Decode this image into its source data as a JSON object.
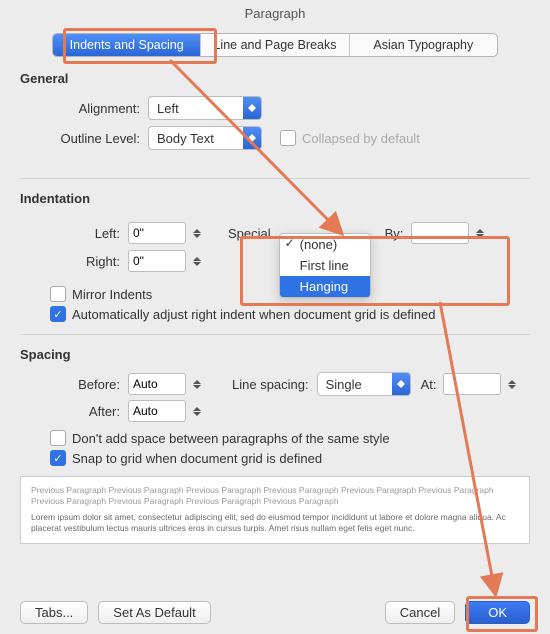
{
  "title": "Paragraph",
  "tabs": [
    "Indents and Spacing",
    "Line and Page Breaks",
    "Asian Typography"
  ],
  "active_tab": 0,
  "general": {
    "title": "General",
    "alignment_label": "Alignment:",
    "alignment_value": "Left",
    "outline_label": "Outline Level:",
    "outline_value": "Body Text",
    "collapsed_label": "Collapsed by default"
  },
  "indentation": {
    "title": "Indentation",
    "left_label": "Left:",
    "left_value": "0\"",
    "right_label": "Right:",
    "right_value": "0\"",
    "special_label": "Special",
    "special_options": [
      "(none)",
      "First line",
      "Hanging"
    ],
    "special_checked": "(none)",
    "special_selected": "Hanging",
    "by_label": "By:",
    "by_value": "",
    "mirror_label": "Mirror Indents",
    "mirror_checked": false,
    "auto_adjust_label": "Automatically adjust right indent when document grid is defined",
    "auto_adjust_checked": true
  },
  "spacing": {
    "title": "Spacing",
    "before_label": "Before:",
    "before_value": "Auto",
    "after_label": "After:",
    "after_value": "Auto",
    "line_spacing_label": "Line spacing:",
    "line_spacing_value": "Single",
    "at_label": "At:",
    "at_value": "",
    "no_space_label": "Don't add space between paragraphs of the same style",
    "no_space_checked": false,
    "snap_label": "Snap to grid when document grid is defined",
    "snap_checked": true
  },
  "preview": {
    "prev_text": "Previous Paragraph Previous Paragraph Previous Paragraph Previous Paragraph Previous Paragraph Previous Paragraph Previous Paragraph Previous Paragraph Previous Paragraph Previous Paragraph",
    "body_text": "Lorem ipsum dolor sit amet, consectetur adipiscing elit, sed do eiusmod tempor incididunt ut labore et dolore magna aliqua. Ac placerat vestibulum lectus mauris ultrices eros in cursus turpis. Amet risus nullam eget felis eget nunc."
  },
  "footer": {
    "tabs_btn": "Tabs...",
    "default_btn": "Set As Default",
    "cancel_btn": "Cancel",
    "ok_btn": "OK"
  },
  "annotations": {
    "color": "#e37a55"
  }
}
